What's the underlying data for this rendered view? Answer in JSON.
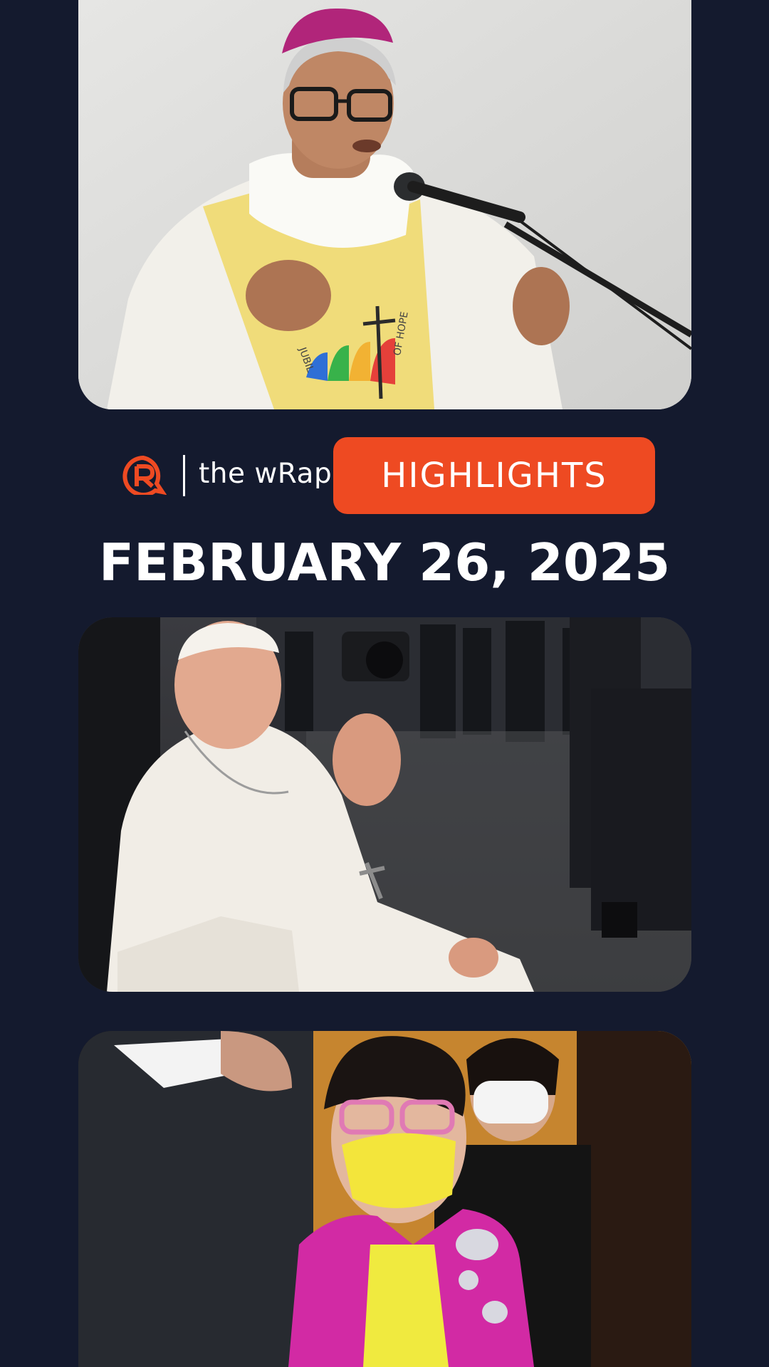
{
  "brand": {
    "logo_icon": "rappler-logo-icon",
    "divider": "|",
    "name": "the wRap",
    "accent_color": "#ee4a22"
  },
  "highlights_button": {
    "label": "HIGHLIGHTS"
  },
  "date": "FEBRUARY 26, 2025",
  "photos": [
    {
      "name": "bishop-speaking-photo",
      "vestment_text_1": "JUBIL",
      "vestment_text_2": "OF HOPE"
    },
    {
      "name": "pope-waving-photo"
    },
    {
      "name": "woman-yellow-mask-photo"
    }
  ],
  "colors": {
    "background": "#141a2e",
    "button": "#ee4a22",
    "text": "#ffffff"
  }
}
